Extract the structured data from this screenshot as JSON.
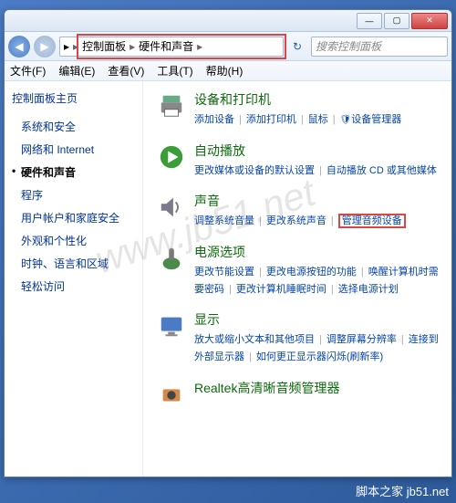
{
  "titlebar": {
    "min": "—",
    "max": "▢",
    "close": "✕"
  },
  "nav": {
    "back": "◀",
    "fwd": "▶"
  },
  "breadcrumb": {
    "root_icon": "▸",
    "item1": "控制面板",
    "item2": "硬件和声音",
    "sep": "▸"
  },
  "search": {
    "placeholder": "搜索控制面板",
    "icon": "🔍"
  },
  "menubar": [
    "文件(F)",
    "编辑(E)",
    "查看(V)",
    "工具(T)",
    "帮助(H)"
  ],
  "sidebar": {
    "heading": "控制面板主页",
    "items": [
      {
        "label": "系统和安全",
        "active": false
      },
      {
        "label": "网络和 Internet",
        "active": false
      },
      {
        "label": "硬件和声音",
        "active": true
      },
      {
        "label": "程序",
        "active": false
      },
      {
        "label": "用户帐户和家庭安全",
        "active": false
      },
      {
        "label": "外观和个性化",
        "active": false
      },
      {
        "label": "时钟、语言和区域",
        "active": false
      },
      {
        "label": "轻松访问",
        "active": false
      }
    ]
  },
  "categories": [
    {
      "title": "设备和打印机",
      "icon": "printer",
      "links": [
        "添加设备",
        "添加打印机",
        "鼠标",
        "设备管理器"
      ],
      "gear": [
        false,
        false,
        false,
        true
      ]
    },
    {
      "title": "自动播放",
      "icon": "play",
      "links": [
        "更改媒体或设备的默认设置",
        "自动播放 CD 或其他媒体"
      ],
      "gear": [
        false,
        false
      ]
    },
    {
      "title": "声音",
      "icon": "sound",
      "links": [
        "调整系统音量",
        "更改系统声音",
        "管理音频设备"
      ],
      "gear": [
        false,
        false,
        false
      ],
      "highlight": 2
    },
    {
      "title": "电源选项",
      "icon": "power",
      "links": [
        "更改节能设置",
        "更改电源按钮的功能",
        "唤醒计算机时需要密码",
        "更改计算机睡眠时间",
        "选择电源计划"
      ],
      "gear": [
        false,
        false,
        false,
        false,
        false
      ]
    },
    {
      "title": "显示",
      "icon": "display",
      "links": [
        "放大或缩小文本和其他项目",
        "调整屏幕分辨率",
        "连接到外部显示器",
        "如何更正显示器闪烁(刷新率)"
      ],
      "gear": [
        false,
        false,
        false,
        false
      ]
    },
    {
      "title": "Realtek高清晰音频管理器",
      "icon": "realtek",
      "links": [],
      "gear": []
    }
  ],
  "watermark": "www.jb51.net",
  "footer": {
    "label": "脚本之家",
    "url": "jb51.net"
  }
}
